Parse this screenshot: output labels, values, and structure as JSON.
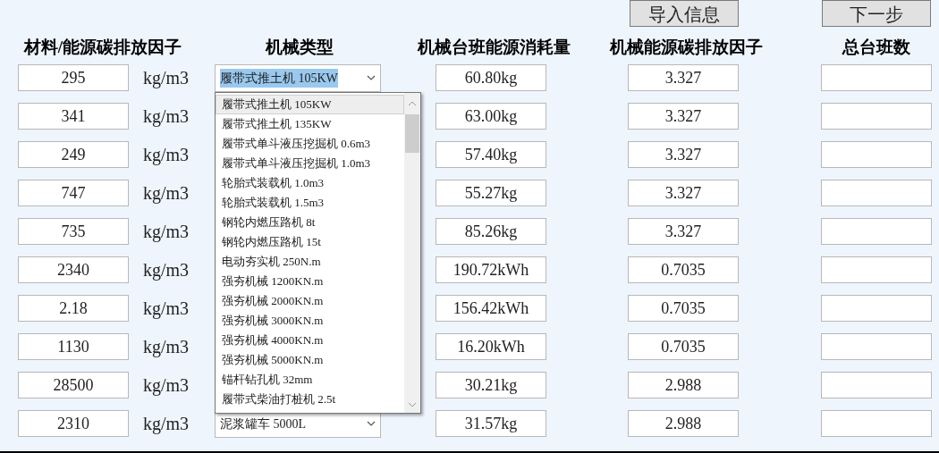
{
  "buttons": [
    {
      "label": "导入信息"
    },
    {
      "label": "下一步"
    }
  ],
  "headers": [
    "材料/能源碳排放因子",
    "机械类型",
    "机械台班能源消耗量",
    "机械能源碳排放因子",
    "总台班数"
  ],
  "rows": [
    {
      "factor": "295",
      "unit": "kg/m3",
      "machine": "履带式推土机 105KW",
      "machine_text_selected": true,
      "consumption": "60.80kg",
      "emission": "3.327"
    },
    {
      "factor": "341",
      "unit": "kg/m3",
      "consumption": "63.00kg",
      "emission": "3.327"
    },
    {
      "factor": "249",
      "unit": "kg/m3",
      "consumption": "57.40kg",
      "emission": "3.327"
    },
    {
      "factor": "747",
      "unit": "kg/m3",
      "consumption": "55.27kg",
      "emission": "3.327"
    },
    {
      "factor": "735",
      "unit": "kg/m3",
      "consumption": "85.26kg",
      "emission": "3.327"
    },
    {
      "factor": "2340",
      "unit": "kg/m3",
      "consumption": "190.72kWh",
      "emission": "0.7035"
    },
    {
      "factor": "2.18",
      "unit": "kg/m3",
      "consumption": "156.42kWh",
      "emission": "0.7035"
    },
    {
      "factor": "1130",
      "unit": "kg/m3",
      "consumption": "16.20kWh",
      "emission": "0.7035"
    },
    {
      "factor": "28500",
      "unit": "kg/m3",
      "consumption": "30.21kg",
      "emission": "2.988"
    },
    {
      "factor": "2310",
      "unit": "kg/m3",
      "machine": "泥浆罐车 5000L",
      "machine_text_selected": false,
      "consumption": "31.57kg",
      "emission": "2.988"
    }
  ],
  "dropdown": {
    "items": [
      {
        "label": "履带式推土机 105KW",
        "selected": true
      },
      {
        "label": "履带式推土机 135KW",
        "selected": false
      },
      {
        "label": "履带式单斗液压挖掘机 0.6m3",
        "selected": false
      },
      {
        "label": "履带式单斗液压挖掘机 1.0m3",
        "selected": false
      },
      {
        "label": "轮胎式装载机 1.0m3",
        "selected": false
      },
      {
        "label": "轮胎式装载机 1.5m3",
        "selected": false
      },
      {
        "label": "钢轮内燃压路机 8t",
        "selected": false
      },
      {
        "label": "钢轮内燃压路机 15t",
        "selected": false
      },
      {
        "label": "电动夯实机 250N.m",
        "selected": false
      },
      {
        "label": "强夯机械 1200KN.m",
        "selected": false
      },
      {
        "label": "强夯机械 2000KN.m",
        "selected": false
      },
      {
        "label": "强夯机械 3000KN.m",
        "selected": false
      },
      {
        "label": "强夯机械 4000KN.m",
        "selected": false
      },
      {
        "label": "强夯机械 5000KN.m",
        "selected": false
      },
      {
        "label": "锚杆钻孔机 32mm",
        "selected": false
      },
      {
        "label": "履带式柴油打桩机 2.5t",
        "selected": false
      }
    ]
  }
}
